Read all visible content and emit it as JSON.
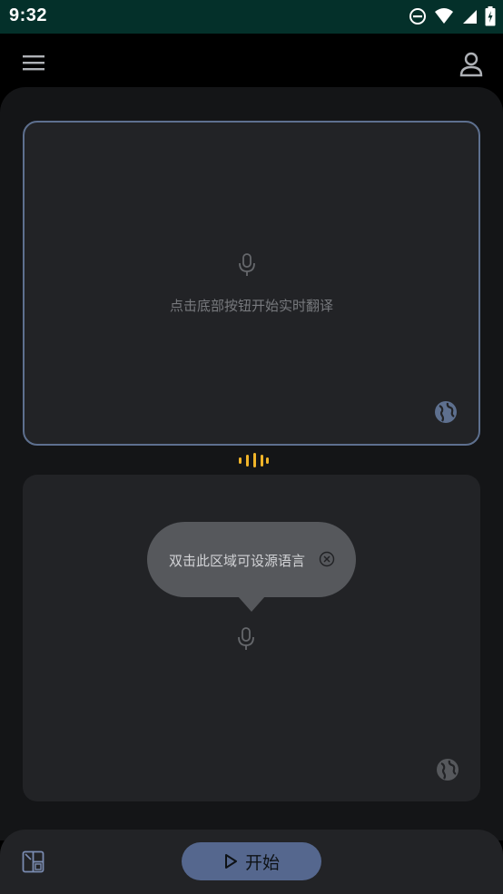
{
  "status_bar": {
    "time": "9:32",
    "icons": [
      "do-not-disturb-icon",
      "wifi-icon",
      "cellular-signal-icon",
      "battery-charging-icon"
    ]
  },
  "header": {
    "menu_icon": "menu-icon",
    "account_icon": "account-icon"
  },
  "source_panel": {
    "mic_icon": "microphone-icon",
    "hint": "点击底部按钮开始实时翻译",
    "language_icon": "globe-icon"
  },
  "divider": {
    "icon": "audio-wave-icon",
    "accent_color": "#f0b429"
  },
  "target_panel": {
    "mic_icon": "microphone-icon",
    "language_icon": "globe-icon",
    "tooltip": {
      "text": "双击此区域可设源语言",
      "close_icon": "close-circle-icon"
    }
  },
  "bottom_bar": {
    "layout_icon": "layout-toggle-icon",
    "start_label": "开始",
    "start_icon": "play-icon"
  },
  "colors": {
    "status_bar_bg": "#04302a",
    "surface": "#141517",
    "card": "#222326",
    "card_border_active": "#5e708f",
    "primary_button": "#55678e"
  }
}
